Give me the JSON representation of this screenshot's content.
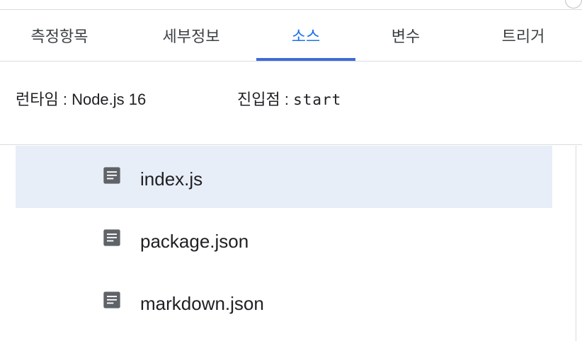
{
  "tabs": [
    {
      "label": "측정항목",
      "active": false
    },
    {
      "label": "세부정보",
      "active": false
    },
    {
      "label": "소스",
      "active": true
    },
    {
      "label": "변수",
      "active": false
    },
    {
      "label": "트리거",
      "active": false
    }
  ],
  "runtime": {
    "label": "런타임",
    "separator": " : ",
    "value": "Node.js 16"
  },
  "entry_point": {
    "label": "진입점",
    "separator": " : ",
    "value": "start"
  },
  "files": [
    {
      "name": "index.js",
      "icon": "document-icon",
      "selected": true
    },
    {
      "name": "package.json",
      "icon": "document-icon",
      "selected": false
    },
    {
      "name": "markdown.json",
      "icon": "document-icon",
      "selected": false
    }
  ],
  "colors": {
    "accent": "#1a73e8",
    "tab_indicator": "#3f6ad8",
    "selected_row": "#e8eef8",
    "icon": "#5f6368"
  }
}
